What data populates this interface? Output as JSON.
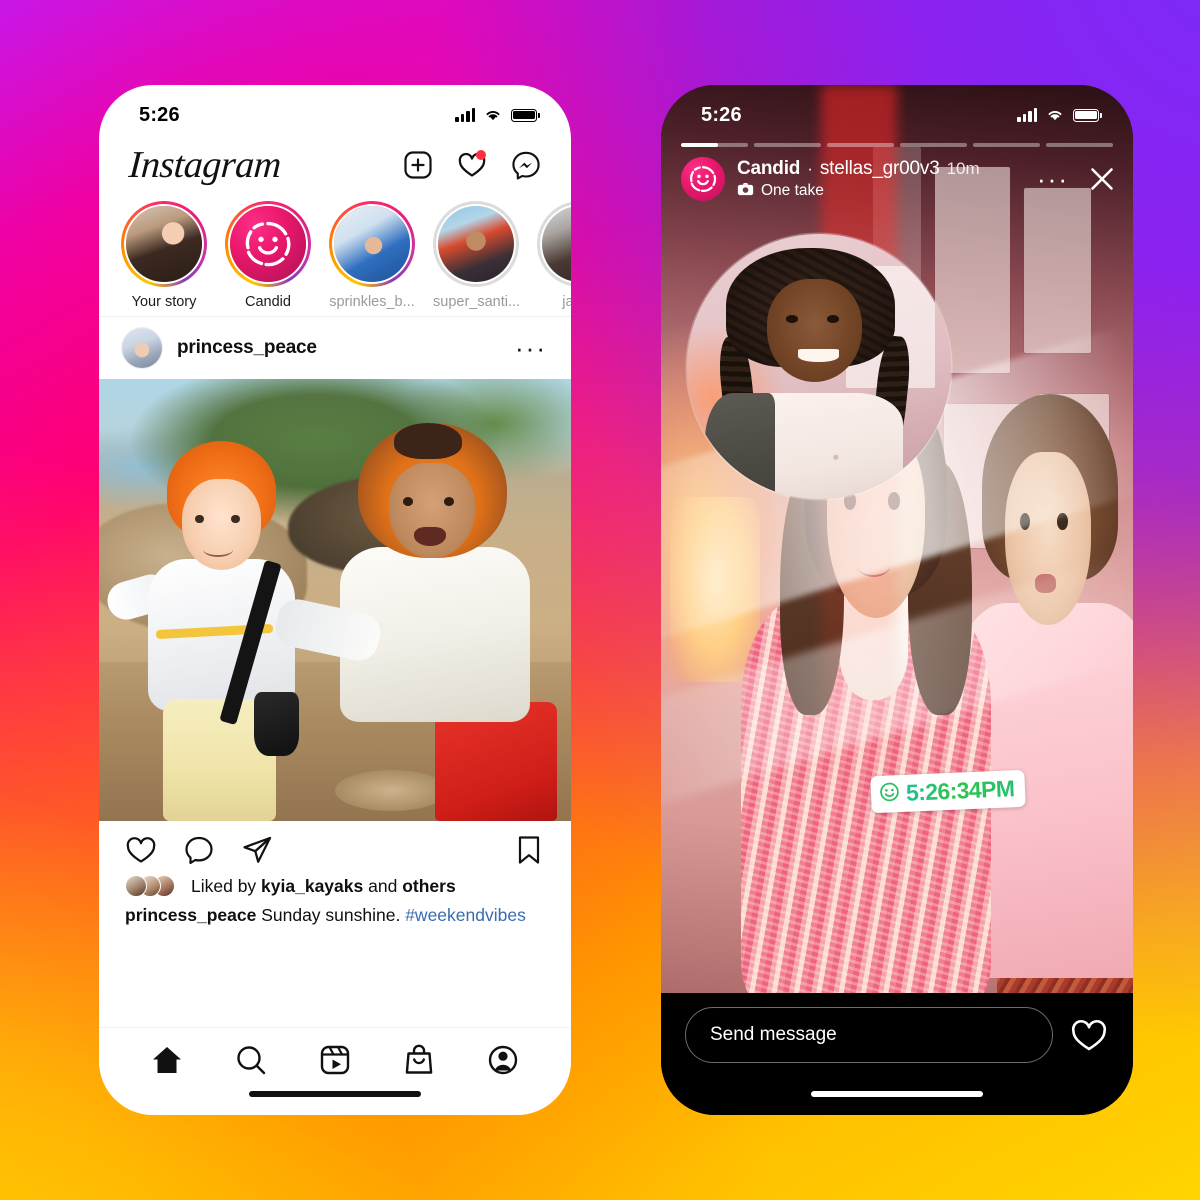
{
  "background": {
    "gradient_from": "#C817E8",
    "gradient_mid": "#FF0070",
    "gradient_to": "#FFD400",
    "accent_purple": "#7B2BF9"
  },
  "left_phone": {
    "status_bar": {
      "time": "5:26",
      "signal_icon": "cellular-signal-icon",
      "wifi_icon": "wifi-icon",
      "battery_icon": "battery-full-icon"
    },
    "header": {
      "logo": "Instagram",
      "icons": [
        {
          "name": "new-post-icon",
          "label": "New post"
        },
        {
          "name": "activity-heart-icon",
          "label": "Activity",
          "badge": true
        },
        {
          "name": "messenger-icon",
          "label": "Messenger"
        }
      ]
    },
    "stories": [
      {
        "label": "Your story",
        "seen": false,
        "type": "photo",
        "dim": false
      },
      {
        "label": "Candid",
        "seen": false,
        "type": "candid",
        "dim": false
      },
      {
        "label": "sprinkles_b...",
        "seen": false,
        "type": "photo",
        "dim": true
      },
      {
        "label": "super_santi...",
        "seen": true,
        "type": "photo",
        "dim": true
      },
      {
        "label": "jaded",
        "seen": true,
        "type": "photo",
        "dim": true
      }
    ],
    "post": {
      "username": "princess_peace",
      "more_icon": "more-options-icon",
      "actions": [
        {
          "name": "like-icon",
          "label": "Like"
        },
        {
          "name": "comment-icon",
          "label": "Comment"
        },
        {
          "name": "share-icon",
          "label": "Share"
        },
        {
          "name": "save-icon",
          "label": "Save"
        }
      ],
      "likes_prefix": "Liked by ",
      "likes_user": "kyia_kayaks",
      "likes_middle": " and ",
      "likes_suffix": "others",
      "caption_user": "princess_peace",
      "caption_text": " Sunday sunshine. ",
      "caption_hashtag": "#weekendvibes",
      "hashtag_color": "#3A6BAF"
    },
    "tabbar": [
      {
        "name": "home-tab-icon",
        "label": "Home",
        "active": true
      },
      {
        "name": "search-tab-icon",
        "label": "Search",
        "active": false
      },
      {
        "name": "reels-tab-icon",
        "label": "Reels",
        "active": false
      },
      {
        "name": "shop-tab-icon",
        "label": "Shop",
        "active": false
      },
      {
        "name": "profile-tab-icon",
        "label": "Profile",
        "active": false
      }
    ]
  },
  "right_phone": {
    "status_bar": {
      "time": "5:26",
      "signal_icon": "cellular-signal-icon",
      "wifi_icon": "wifi-icon",
      "battery_icon": "battery-full-icon"
    },
    "progress": {
      "segments": 6,
      "current_index": 0,
      "current_fill_percent": 55
    },
    "story_header": {
      "avatar_icon": "candid-smiley-icon",
      "title": "Candid",
      "separator": "·",
      "handle": "stellas_gr00v3",
      "time_ago": "10m",
      "badge_icon": "camera-icon",
      "badge_label": "One take",
      "more_icon": "more-options-icon",
      "close_icon": "close-icon"
    },
    "sticker": {
      "icon": "smiley-outline-icon",
      "text": "5:26:34PM",
      "text_gradient_from": "#1FBF9A",
      "text_gradient_to": "#27C06F",
      "background": "#FFFFFF"
    },
    "footer": {
      "message_placeholder": "Send message",
      "heart_icon": "like-heart-icon"
    }
  }
}
